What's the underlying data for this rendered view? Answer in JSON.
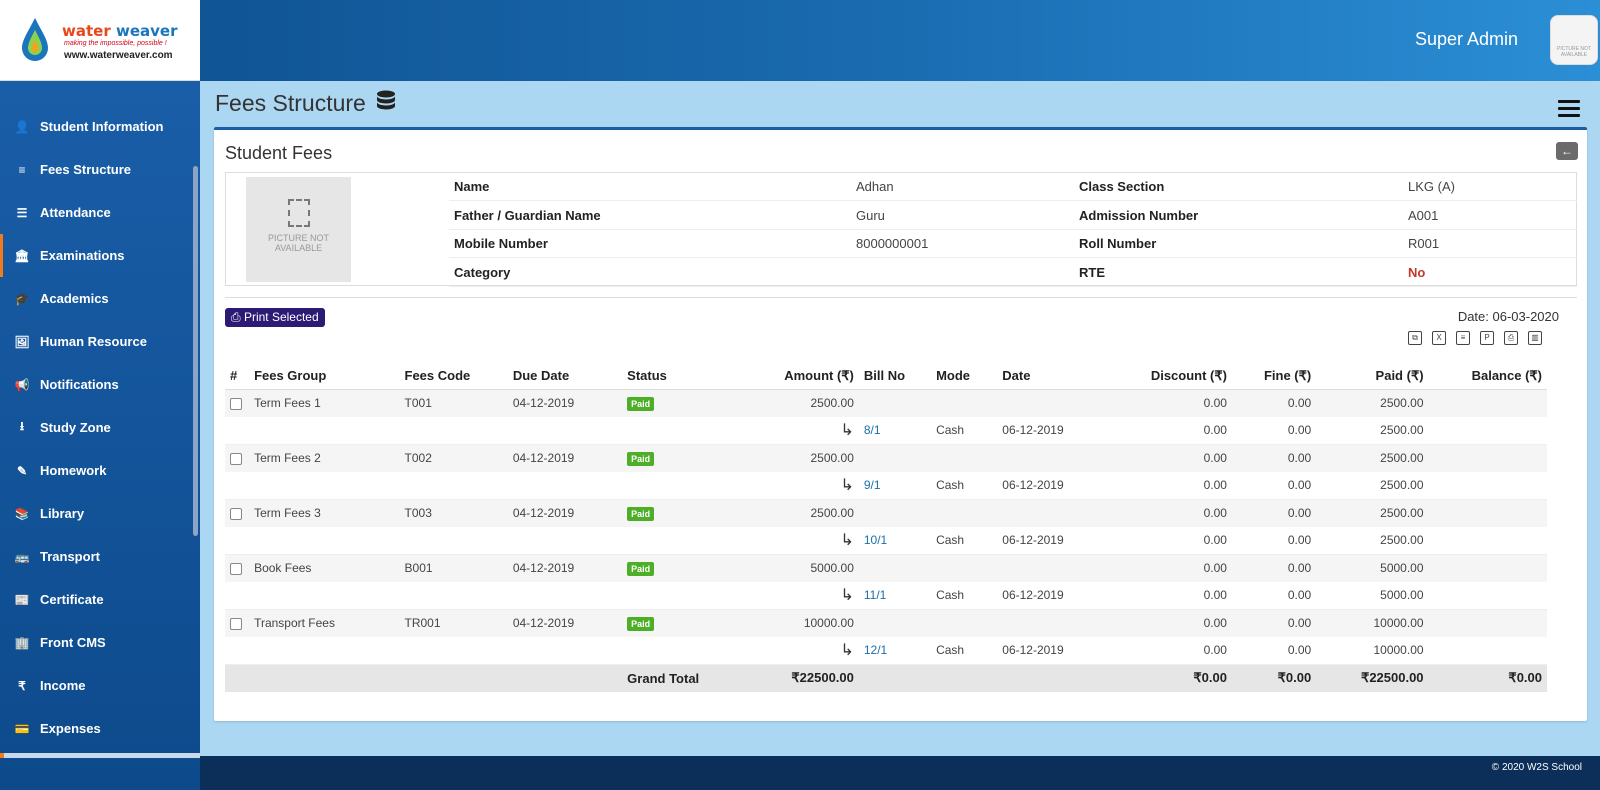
{
  "brand": {
    "name_part1": "water",
    "name_part2": "weaver",
    "tagline": "making the impossible, possible !",
    "url": "www.waterweaver.com"
  },
  "user": {
    "name": "Super Admin",
    "avatar_text": "PICTURE NOT AVAILABLE"
  },
  "sidebar": {
    "items": [
      {
        "label": "Student Information",
        "icon": "user-icon"
      },
      {
        "label": "Fees Structure",
        "icon": "database-icon"
      },
      {
        "label": "Attendance",
        "icon": "list-icon"
      },
      {
        "label": "Examinations",
        "icon": "institution-icon"
      },
      {
        "label": "Academics",
        "icon": "graduation-cap-icon"
      },
      {
        "label": "Human Resource",
        "icon": "sitemap-icon"
      },
      {
        "label": "Notifications",
        "icon": "bullhorn-icon"
      },
      {
        "label": "Study Zone",
        "icon": "download-icon"
      },
      {
        "label": "Homework",
        "icon": "edit-icon"
      },
      {
        "label": "Library",
        "icon": "book-icon"
      },
      {
        "label": "Transport",
        "icon": "bus-icon"
      },
      {
        "label": "Certificate",
        "icon": "newspaper-icon"
      },
      {
        "label": "Front CMS",
        "icon": "empire-icon"
      },
      {
        "label": "Income",
        "icon": "rupee-icon"
      },
      {
        "label": "Expenses",
        "icon": "credit-card-icon"
      }
    ]
  },
  "page": {
    "title": "Fees Structure",
    "section_title": "Student Fees"
  },
  "student": {
    "photo_text": "PICTURE NOT AVAILABLE",
    "rows": [
      {
        "k1": "Name",
        "v1": "Adhan",
        "k2": "Class Section",
        "v2": "LKG (A)"
      },
      {
        "k1": "Father / Guardian Name",
        "v1": "Guru",
        "k2": "Admission Number",
        "v2": "A001"
      },
      {
        "k1": "Mobile Number",
        "v1": "8000000001",
        "k2": "Roll Number",
        "v2": "R001"
      },
      {
        "k1": "Category",
        "v1": "",
        "k2": "RTE",
        "v2": "No"
      }
    ]
  },
  "actions": {
    "print_selected": "Print Selected",
    "date": "Date: 06-03-2020"
  },
  "table": {
    "headers": [
      "#",
      "Fees Group",
      "Fees Code",
      "Due Date",
      "Status",
      "Amount (₹)",
      "Bill No",
      "Mode",
      "Date",
      "Discount (₹)",
      "Fine (₹)",
      "Paid (₹)",
      "Balance (₹)"
    ],
    "groups": [
      {
        "group": "Term Fees 1",
        "code": "T001",
        "due": "04-12-2019",
        "status": "Paid",
        "amount": "2500.00",
        "discount": "0.00",
        "fine": "0.00",
        "paid": "2500.00",
        "bill": "8/1",
        "mode": "Cash",
        "date": "06-12-2019",
        "p_discount": "0.00",
        "p_fine": "0.00",
        "p_paid": "2500.00"
      },
      {
        "group": "Term Fees 2",
        "code": "T002",
        "due": "04-12-2019",
        "status": "Paid",
        "amount": "2500.00",
        "discount": "0.00",
        "fine": "0.00",
        "paid": "2500.00",
        "bill": "9/1",
        "mode": "Cash",
        "date": "06-12-2019",
        "p_discount": "0.00",
        "p_fine": "0.00",
        "p_paid": "2500.00"
      },
      {
        "group": "Term Fees 3",
        "code": "T003",
        "due": "04-12-2019",
        "status": "Paid",
        "amount": "2500.00",
        "discount": "0.00",
        "fine": "0.00",
        "paid": "2500.00",
        "bill": "10/1",
        "mode": "Cash",
        "date": "06-12-2019",
        "p_discount": "0.00",
        "p_fine": "0.00",
        "p_paid": "2500.00"
      },
      {
        "group": "Book Fees",
        "code": "B001",
        "due": "04-12-2019",
        "status": "Paid",
        "amount": "5000.00",
        "discount": "0.00",
        "fine": "0.00",
        "paid": "5000.00",
        "bill": "11/1",
        "mode": "Cash",
        "date": "06-12-2019",
        "p_discount": "0.00",
        "p_fine": "0.00",
        "p_paid": "5000.00"
      },
      {
        "group": "Transport Fees",
        "code": "TR001",
        "due": "04-12-2019",
        "status": "Paid",
        "amount": "10000.00",
        "discount": "0.00",
        "fine": "0.00",
        "paid": "10000.00",
        "bill": "12/1",
        "mode": "Cash",
        "date": "06-12-2019",
        "p_discount": "0.00",
        "p_fine": "0.00",
        "p_paid": "10000.00"
      }
    ],
    "total": {
      "label": "Grand Total",
      "amount": "₹22500.00",
      "discount": "₹0.00",
      "fine": "₹0.00",
      "paid": "₹22500.00",
      "balance": "₹0.00"
    }
  },
  "footer": {
    "text": "© 2020 W2S School"
  },
  "colors": {
    "primary": "#1a5ea8",
    "accent": "#f07b1c",
    "paid_badge": "#4caf27",
    "print_button": "#2d1a75"
  }
}
